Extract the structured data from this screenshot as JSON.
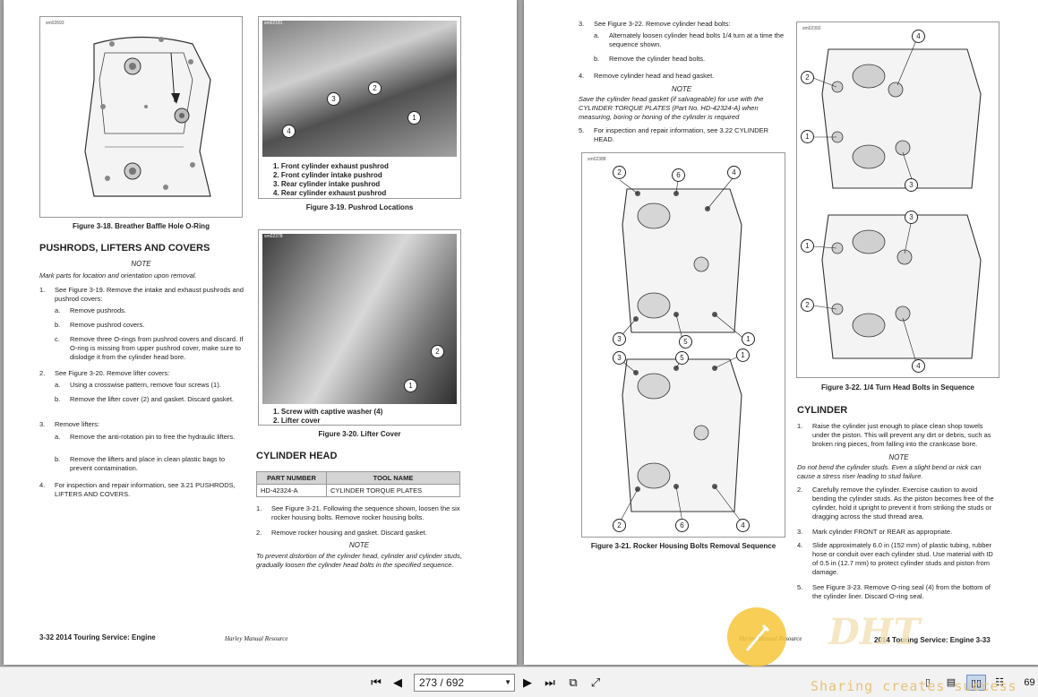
{
  "viewer": {
    "page_input": "273 / 692",
    "right_edge_number": "69",
    "watermark": "Sharing creates success",
    "watermark_logo": "DHT"
  },
  "left": {
    "fig18": {
      "id": "sm02693",
      "caption": "Figure 3-18. Breather Baffle Hole O-Ring"
    },
    "fig19": {
      "id": "sm02181",
      "caption": "Figure 3-19. Pushrod Locations",
      "legend": [
        "1.  Front cylinder exhaust pushrod",
        "2.  Front cylinder intake pushrod",
        "3.  Rear cylinder intake pushrod",
        "4.  Rear cylinder exhaust pushrod"
      ],
      "callouts": [
        "1",
        "2",
        "3",
        "4"
      ]
    },
    "fig20": {
      "id": "sm02378",
      "caption": "Figure 3-20. Lifter Cover",
      "legend": [
        "1.  Screw with captive washer (4)",
        "2.  Lifter cover"
      ],
      "callouts": [
        "1",
        "2"
      ]
    },
    "pushrods": {
      "heading": "PUSHRODS, LIFTERS AND COVERS",
      "note_label": "NOTE",
      "note": "Mark parts for location and orientation upon removal.",
      "steps": [
        {
          "n": "1.",
          "t": "See Figure 3-19. Remove the intake and exhaust pushrods and pushrod covers:"
        },
        {
          "n": "a.",
          "t": "Remove pushrods."
        },
        {
          "n": "b.",
          "t": "Remove pushrod covers."
        },
        {
          "n": "c.",
          "t": "Remove three O-rings from pushrod covers and discard. If O-ring is missing from upper pushrod cover, make sure to dislodge it from the cylinder head bore."
        },
        {
          "n": "2.",
          "t": "See Figure 3-20. Remove lifter covers:"
        },
        {
          "n": "a.",
          "t": "Using a crosswise pattern, remove four screws (1)."
        },
        {
          "n": "b.",
          "t": "Remove the lifter cover (2) and gasket. Discard gasket."
        },
        {
          "n": "3.",
          "t": "Remove lifters:"
        },
        {
          "n": "a.",
          "t": "Remove the anti-rotation pin to free the hydraulic lifters."
        },
        {
          "n": "b.",
          "t": "Remove the lifters and place in clean plastic bags to prevent contamination."
        },
        {
          "n": "4.",
          "t": "For inspection and repair information, see 3.21 PUSHRODS, LIFTERS AND COVERS."
        }
      ]
    },
    "cylinder_head": {
      "heading": "CYLINDER HEAD",
      "table_headers": [
        "PART NUMBER",
        "TOOL NAME"
      ],
      "table_row": [
        "HD-42324-A",
        "CYLINDER TORQUE PLATES"
      ],
      "steps": [
        {
          "n": "1.",
          "t": "See Figure 3-21. Following the sequence shown, loosen the six rocker housing bolts. Remove rocker housing bolts."
        },
        {
          "n": "2.",
          "t": "Remove rocker housing and gasket. Discard gasket."
        }
      ],
      "note_label": "NOTE",
      "note": "To prevent distortion of the cylinder head, cylinder and cylinder studs, gradually loosen the cylinder head bolts in the specified sequence."
    },
    "footer_left": "3-32  2014 Touring Service:  Engine",
    "footer_center": "Harley Manual Resource"
  },
  "right": {
    "steps_top": [
      {
        "n": "3.",
        "t": "See Figure 3-22. Remove cylinder head bolts:"
      },
      {
        "n": "a.",
        "t": "Alternately loosen cylinder head bolts 1/4 turn at a time the sequence shown."
      },
      {
        "n": "b.",
        "t": "Remove the cylinder head bolts."
      },
      {
        "n": "4.",
        "t": "Remove cylinder head and head gasket."
      }
    ],
    "note_label": "NOTE",
    "note": "Save the cylinder head gasket (if salvageable) for use with the CYLINDER TORQUE PLATES (Part No. HD-42324-A) when measuring, boring or honing of the cylinder is required",
    "step5": {
      "n": "5.",
      "t": "For inspection and repair information, see 3.22 CYLINDER HEAD."
    },
    "fig21": {
      "id": "sm02388",
      "caption": "Figure 3-21. Rocker Housing Bolts Removal Sequence",
      "callouts_top": [
        "2",
        "6",
        "4",
        "3",
        "5",
        "1"
      ],
      "callouts_bottom": [
        "3",
        "5",
        "1",
        "2",
        "6",
        "4"
      ]
    },
    "fig22": {
      "id": "sm02392",
      "caption": "Figure 3-22. 1/4 Turn Head Bolts in Sequence",
      "callouts_top": [
        "4",
        "2",
        "1",
        "3"
      ],
      "callouts_bottom": [
        "3",
        "1",
        "2",
        "4"
      ]
    },
    "cylinder": {
      "heading": "CYLINDER",
      "step1": {
        "n": "1.",
        "t": "Raise the cylinder just enough to place clean shop towels under the piston. This will prevent any dirt or debris, such as broken ring pieces, from falling into the crankcase bore."
      },
      "note_label": "NOTE",
      "note": "Do not bend the cylinder studs. Even a slight bend or nick can cause a stress riser leading to stud failure.",
      "steps": [
        {
          "n": "2.",
          "t": "Carefully remove the cylinder. Exercise caution to avoid bending the cylinder studs. As the piston becomes free of the cylinder, hold it upright to prevent it from striking the studs or dragging across the stud thread area."
        },
        {
          "n": "3.",
          "t": "Mark cylinder FRONT or REAR as appropriate."
        },
        {
          "n": "4.",
          "t": "Slide approximately 6.0 in (152 mm) of plastic tubing, rubber hose or conduit over each cylinder stud. Use material with ID of 0.5 in (12.7 mm) to protect cylinder studs and piston from damage."
        },
        {
          "n": "5.",
          "t": "See Figure 3-23. Remove O-ring seal (4) from the bottom of the cylinder liner. Discard O-ring seal."
        }
      ]
    },
    "footer_center": "Harley Manual Resource",
    "footer_right": "2014 Touring Service:  Engine  3-33"
  }
}
